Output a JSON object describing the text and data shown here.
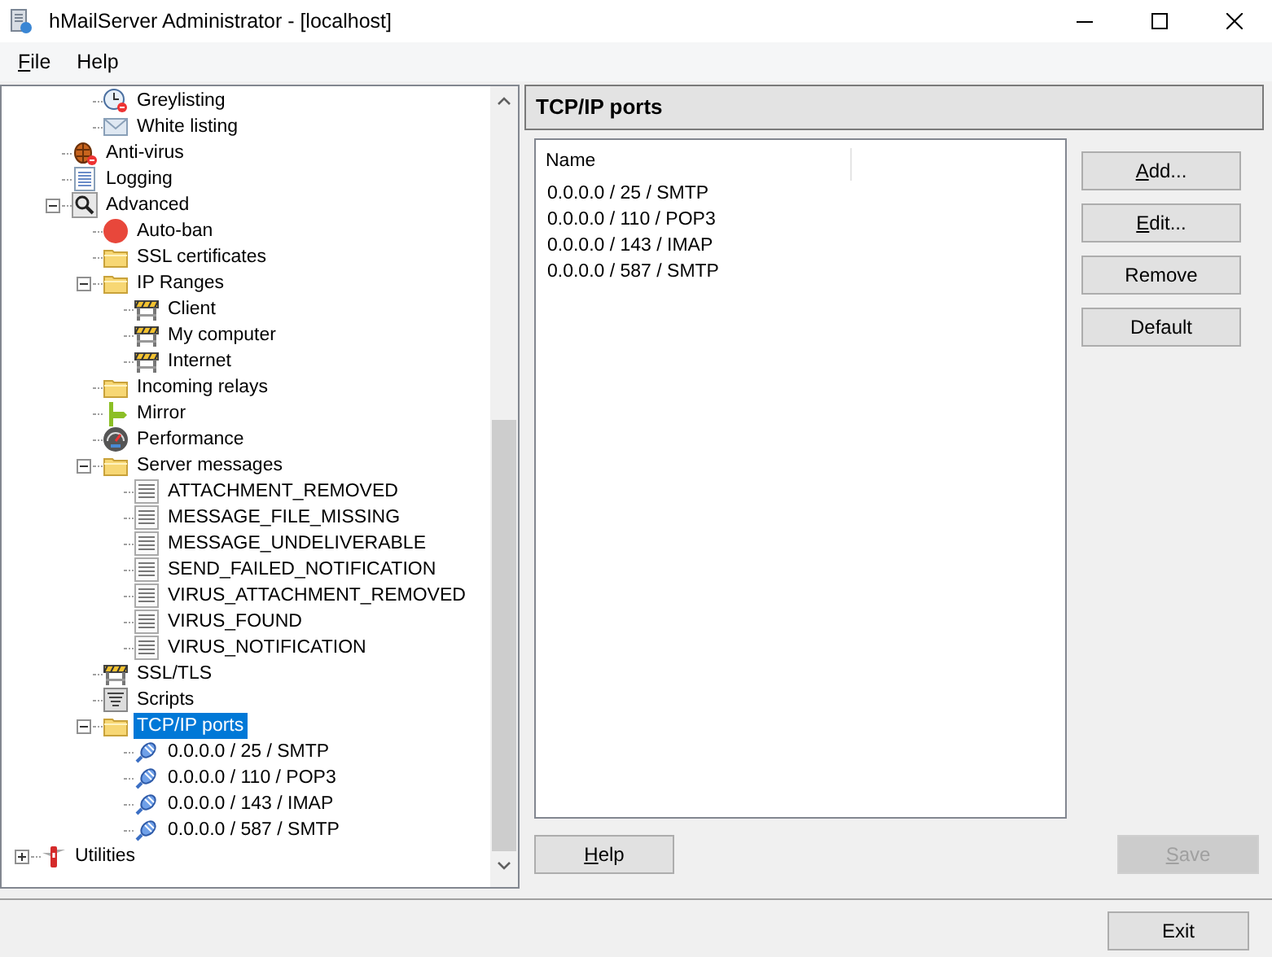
{
  "window": {
    "title": "hMailServer Administrator - [localhost]"
  },
  "menu": [
    {
      "label": "File",
      "mnemonic_underlined": true
    },
    {
      "label": "Help",
      "mnemonic_underlined": false
    }
  ],
  "tree": {
    "items": [
      {
        "children": [
          {
            "children": [
              {
                "label": "Greylisting",
                "kind": "clock",
                "selected": false
              },
              {
                "label": "White listing",
                "kind": "mail",
                "selected": false
              }
            ]
          },
          {
            "label": "Anti-virus",
            "kind": "bug",
            "selected": false
          },
          {
            "label": "Logging",
            "kind": "log",
            "selected": false
          },
          {
            "label": "Advanced",
            "kind": "magnifier",
            "selected": false,
            "expanded": true,
            "children": [
              {
                "label": "Auto-ban",
                "kind": "stop",
                "selected": false
              },
              {
                "label": "SSL certificates",
                "kind": "folder",
                "selected": false
              },
              {
                "label": "IP Ranges",
                "kind": "folder",
                "selected": false,
                "expanded": true,
                "children": [
                  {
                    "label": "Client",
                    "kind": "barrier",
                    "selected": false
                  },
                  {
                    "label": "My computer",
                    "kind": "barrier",
                    "selected": false
                  },
                  {
                    "label": "Internet",
                    "kind": "barrier",
                    "selected": false
                  }
                ]
              },
              {
                "label": "Incoming relays",
                "kind": "folder",
                "selected": false
              },
              {
                "label": "Mirror",
                "kind": "signpost",
                "selected": false
              },
              {
                "label": "Performance",
                "kind": "gauge",
                "selected": false
              },
              {
                "label": "Server messages",
                "kind": "folder",
                "selected": false,
                "expanded": true,
                "children": [
                  {
                    "label": "ATTACHMENT_REMOVED",
                    "kind": "document",
                    "selected": false
                  },
                  {
                    "label": "MESSAGE_FILE_MISSING",
                    "kind": "document",
                    "selected": false
                  },
                  {
                    "label": "MESSAGE_UNDELIVERABLE",
                    "kind": "document",
                    "selected": false
                  },
                  {
                    "label": "SEND_FAILED_NOTIFICATION",
                    "kind": "document",
                    "selected": false
                  },
                  {
                    "label": "VIRUS_ATTACHMENT_REMOVED",
                    "kind": "document",
                    "selected": false
                  },
                  {
                    "label": "VIRUS_FOUND",
                    "kind": "document",
                    "selected": false
                  },
                  {
                    "label": "VIRUS_NOTIFICATION",
                    "kind": "document",
                    "selected": false
                  }
                ]
              },
              {
                "label": "SSL/TLS",
                "kind": "barrier",
                "selected": false
              },
              {
                "label": "Scripts",
                "kind": "script",
                "selected": false
              },
              {
                "label": "TCP/IP ports",
                "kind": "folder",
                "selected": true,
                "expanded": true,
                "children": [
                  {
                    "label": "0.0.0.0 / 25 / SMTP",
                    "kind": "plug",
                    "selected": false
                  },
                  {
                    "label": "0.0.0.0 / 110 / POP3",
                    "kind": "plug",
                    "selected": false
                  },
                  {
                    "label": "0.0.0.0 / 143 / IMAP",
                    "kind": "plug",
                    "selected": false
                  },
                  {
                    "label": "0.0.0.0 / 587 / SMTP",
                    "kind": "plug",
                    "selected": false
                  }
                ]
              }
            ]
          }
        ]
      },
      {
        "label": "Utilities",
        "kind": "knife",
        "selected": false,
        "expanded": false
      }
    ]
  },
  "panel": {
    "title": "TCP/IP ports",
    "list": {
      "columns": [
        "Name"
      ],
      "rows": [
        "0.0.0.0 / 25 / SMTP",
        "0.0.0.0 / 110 / POP3",
        "0.0.0.0 / 143 / IMAP",
        "0.0.0.0 / 587 / SMTP"
      ]
    },
    "buttons": [
      {
        "label": "Add...",
        "mnemonic_underlined": true,
        "disabled": false
      },
      {
        "label": "Edit...",
        "mnemonic_underlined": true,
        "disabled": false
      },
      {
        "label": "Remove",
        "mnemonic_underlined": false,
        "disabled": false
      },
      {
        "label": "Default",
        "mnemonic_underlined": false,
        "disabled": false
      }
    ],
    "help_button": {
      "label": "Help",
      "mnemonic_underlined": true,
      "disabled": false
    },
    "save_button": {
      "label": "Save",
      "mnemonic_underlined": true,
      "disabled": true
    }
  },
  "exit_button": {
    "label": "Exit",
    "mnemonic_underlined": false,
    "disabled": false
  }
}
